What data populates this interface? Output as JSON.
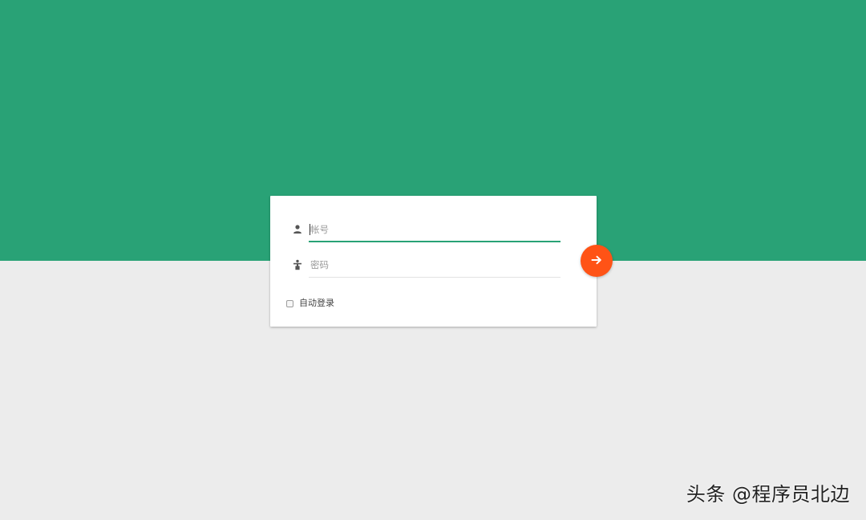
{
  "theme": {
    "top_band_color": "#29a276",
    "background_color": "#ececec",
    "accent_color": "#ff5316"
  },
  "login": {
    "account": {
      "icon": "user-icon",
      "placeholder": "帐号",
      "value": ""
    },
    "password": {
      "icon": "key-icon",
      "placeholder": "密码",
      "value": ""
    },
    "remember": {
      "label": "自动登录",
      "checked": false
    },
    "submit": {
      "icon": "arrow-right-icon"
    }
  },
  "watermark": {
    "text": "头条 @程序员北边"
  }
}
